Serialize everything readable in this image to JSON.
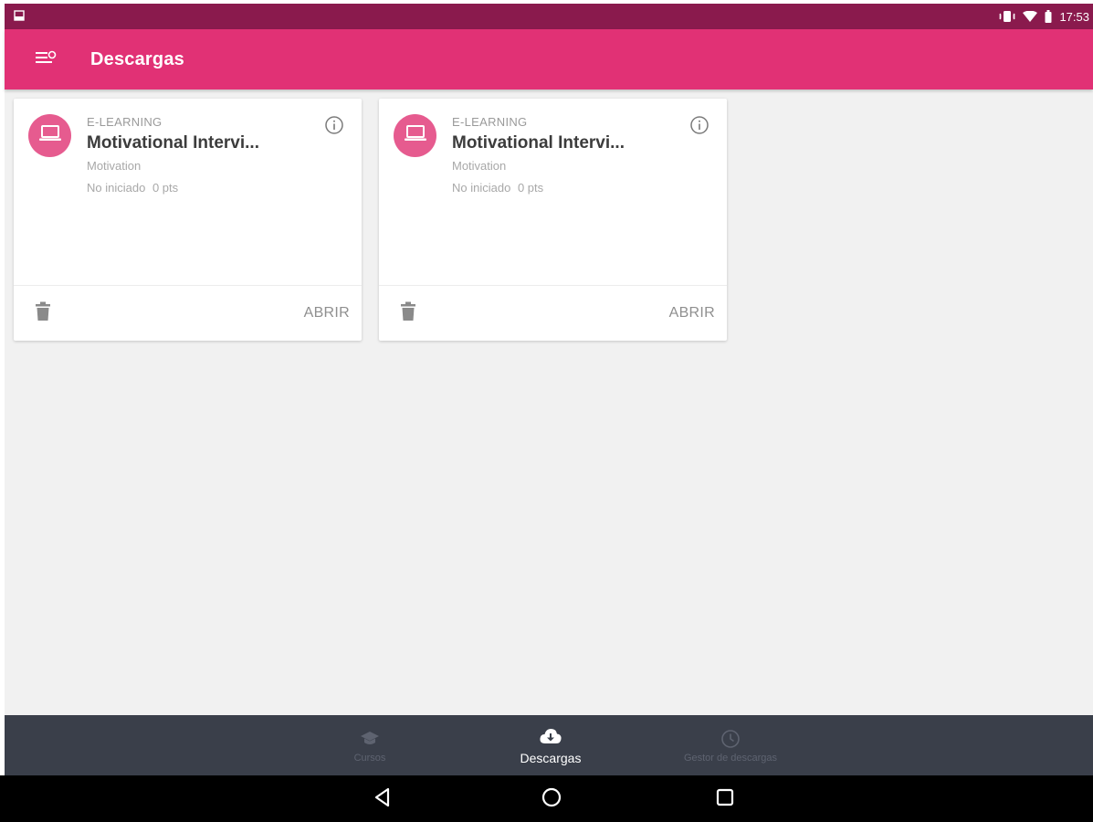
{
  "status_bar": {
    "time": "17:53",
    "icons": [
      "notification-icon",
      "vibrate-icon",
      "wifi-icon",
      "battery-icon"
    ]
  },
  "app_bar": {
    "title": "Descargas",
    "menu_icon": "menu-icon",
    "background": "#e13175"
  },
  "cards": [
    {
      "type": "E-LEARNING",
      "title": "Motivational Intervi...",
      "subtitle": "Motivation",
      "status": "No iniciado",
      "points": "0 pts",
      "icon": "laptop-icon",
      "info_icon": "info-icon",
      "delete_icon": "trash-icon",
      "action_label": "ABRIR"
    },
    {
      "type": "E-LEARNING",
      "title": "Motivational Intervi...",
      "subtitle": "Motivation",
      "status": "No iniciado",
      "points": "0 pts",
      "icon": "laptop-icon",
      "info_icon": "info-icon",
      "delete_icon": "trash-icon",
      "action_label": "ABRIR"
    }
  ],
  "bottom_nav": {
    "items": [
      {
        "label": "Cursos",
        "icon": "graduation-cap-icon",
        "active": false
      },
      {
        "label": "Descargas",
        "icon": "cloud-download-icon",
        "active": true
      },
      {
        "label": "Gestor de descargas",
        "icon": "clock-icon",
        "active": false
      }
    ]
  },
  "system_nav": {
    "buttons": [
      "back-icon",
      "home-icon",
      "recent-apps-icon"
    ]
  },
  "colors": {
    "accent": "#e13175",
    "status_bar": "#8a1a4d",
    "avatar": "#e65b8f",
    "bottom_nav": "#3a3f4a"
  }
}
